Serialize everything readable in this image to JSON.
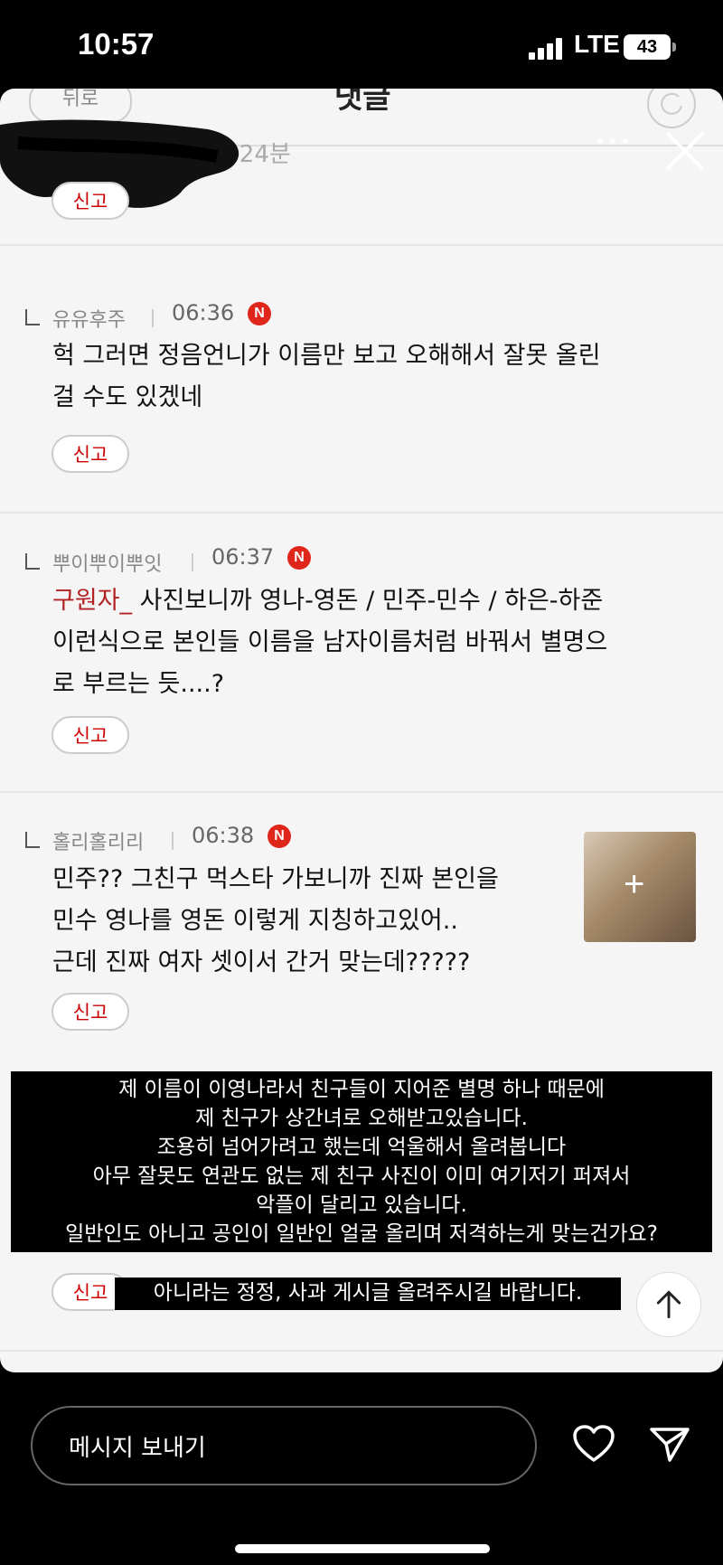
{
  "status_bar": {
    "time": "10:57",
    "network": "LTE",
    "battery": "43"
  },
  "page": {
    "back_label": "뒤로",
    "title": "댓글"
  },
  "top_partial": {
    "meta": "24분",
    "report_label": "신고"
  },
  "comments": [
    {
      "author": "유유후주",
      "time": "06:36",
      "badge": "N",
      "lines": [
        "헉 그러면 정음언니가 이름만 보고 오해해서 잘못 올린",
        "걸 수도 있겠네"
      ],
      "report_label": "신고"
    },
    {
      "author": "뿌이뿌이뿌잇",
      "time": "06:37",
      "badge": "N",
      "mention": "구원자_",
      "lines": [
        " 사진보니까 영나-영돈 / 민주-민수 / 하은-하준",
        "이런식으로 본인들 이름을 남자이름처럼 바꿔서 별명으",
        "로 부르는 듯....?"
      ],
      "report_label": "신고"
    },
    {
      "author": "홀리홀리리",
      "time": "06:38",
      "badge": "N",
      "lines": [
        "민주?? 그친구 먹스타 가보니까 진짜 본인을",
        "민수 영나를 영돈 이렇게 지칭하고있어..",
        "근데 진짜 여자 셋이서 간거 맞는데?????"
      ],
      "report_label": "신고"
    }
  ],
  "overlay": {
    "lines": [
      "제 이름이 이영나라서 친구들이 지어준 별명 하나 때문에",
      "제 친구가 상간녀로 오해받고있습니다.",
      "조용히 넘어가려고 했는데 억울해서 올려봅니다",
      "아무 잘못도 연관도 없는 제 친구 사진이 이미 여기저기 퍼져서",
      "악플이 달리고 있습니다.",
      "일반인도 아니고 공인이 일반인 얼굴 올리며 저격하는게 맞는건가요?"
    ],
    "last_line": "아니라는 정정, 사과 게시글 올려주시길 바랍니다.",
    "partial_report": "신고"
  },
  "message_bar": {
    "placeholder": "메시지 보내기"
  },
  "icons": [
    "signal-icon",
    "refresh-icon",
    "more-icon",
    "close-icon",
    "n-badge",
    "image-thumbnail",
    "scroll-top-icon",
    "heart-icon",
    "send-icon"
  ]
}
